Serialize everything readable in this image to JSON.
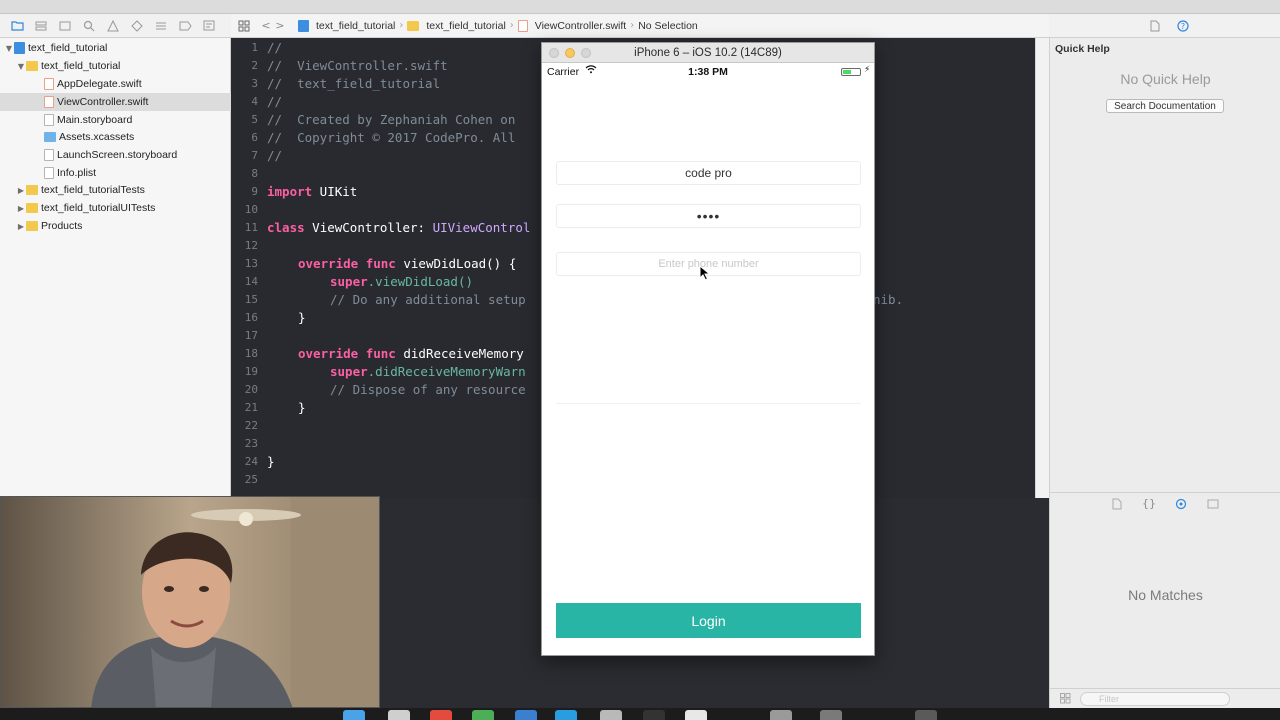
{
  "navigator": {
    "items": [
      {
        "label": "text_field_tutorial",
        "kind": "project",
        "depth": 0,
        "expanded": true
      },
      {
        "label": "text_field_tutorial",
        "kind": "folder",
        "depth": 1,
        "expanded": true
      },
      {
        "label": "AppDelegate.swift",
        "kind": "swift",
        "depth": 2
      },
      {
        "label": "ViewController.swift",
        "kind": "swift",
        "depth": 2,
        "selected": true
      },
      {
        "label": "Main.storyboard",
        "kind": "file",
        "depth": 2
      },
      {
        "label": "Assets.xcassets",
        "kind": "assets",
        "depth": 2
      },
      {
        "label": "LaunchScreen.storyboard",
        "kind": "file",
        "depth": 2
      },
      {
        "label": "Info.plist",
        "kind": "file",
        "depth": 2
      },
      {
        "label": "text_field_tutorialTests",
        "kind": "folder",
        "depth": 1,
        "expanded": false
      },
      {
        "label": "text_field_tutorialUITests",
        "kind": "folder",
        "depth": 1,
        "expanded": false
      },
      {
        "label": "Products",
        "kind": "folder",
        "depth": 1,
        "expanded": false
      }
    ]
  },
  "breadcrumb": {
    "items": [
      "text_field_tutorial",
      "text_field_tutorial",
      "ViewController.swift",
      "No Selection"
    ]
  },
  "editor": {
    "line_numbers": [
      "1",
      "2",
      "3",
      "4",
      "5",
      "6",
      "7",
      "8",
      "9",
      "10",
      "11",
      "12",
      "13",
      "14",
      "15",
      "16",
      "17",
      "18",
      "19",
      "20",
      "21",
      "22",
      "23",
      "24",
      "25"
    ],
    "lines": {
      "l1": "//",
      "l2": "//  ViewController.swift",
      "l3": "//  text_field_tutorial",
      "l4": "//",
      "l5": "//  Created by Zephaniah Cohen on",
      "l6": "//  Copyright © 2017 CodePro. All",
      "l7": "//",
      "l9_kw": "import",
      "l9_rest": " UIKit",
      "l11_kw": "class",
      "l11_name": " ViewController: ",
      "l11_type": "UIViewControl",
      "l13_kw": "override func",
      "l13_rest": " viewDidLoad() {",
      "l14_super": "super",
      "l14_call": ".viewDidLoad()",
      "l15": "// Do any additional setup",
      "l15_tail": "nib.",
      "l16": "}",
      "l18_kw": "override func",
      "l18_rest": " didReceiveMemory",
      "l19_super": "super",
      "l19_call": ".didReceiveMemoryWarn",
      "l20": "// Dispose of any resource",
      "l21": "}",
      "l24": "}"
    }
  },
  "simulator": {
    "title": "iPhone 6 – iOS 10.2 (14C89)",
    "carrier": "Carrier",
    "time": "1:38 PM",
    "battery_level": 0.5,
    "fields": {
      "username_value": "code pro",
      "password_value": "••••",
      "phone_placeholder": "Enter phone number"
    },
    "login_label": "Login",
    "login_color": "#29b5a5"
  },
  "inspector": {
    "title": "Quick Help",
    "empty_text": "No Quick Help",
    "search_docs_label": "Search Documentation"
  },
  "library": {
    "empty_text": "No Matches",
    "filter_placeholder": "Filter"
  },
  "colors": {
    "editor_bg": "#292a30",
    "comment": "#7f8c98",
    "keyword": "#fc5fa3",
    "type": "#d0a8ff",
    "call": "#67b7a4"
  }
}
